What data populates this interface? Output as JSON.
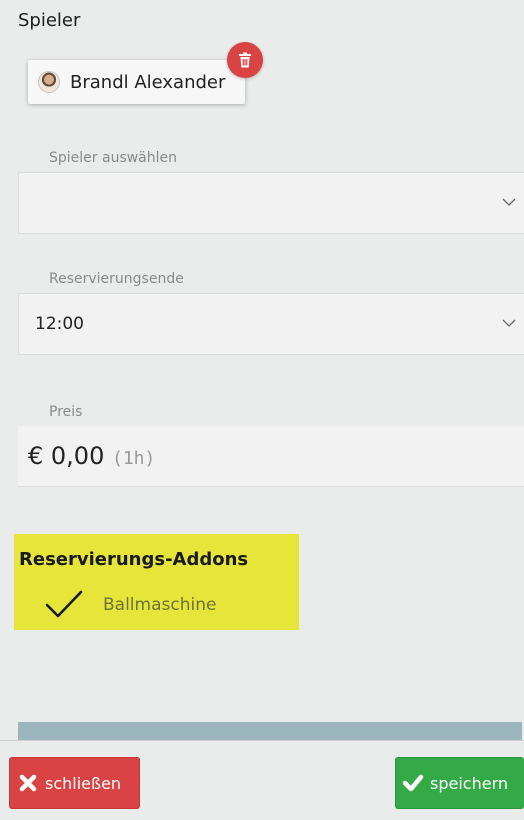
{
  "section": {
    "title": "Spieler"
  },
  "selected_player": {
    "name": "Brandl Alexander"
  },
  "player_select": {
    "label": "Spieler auswählen",
    "value": ""
  },
  "end_select": {
    "label": "Reservierungsende",
    "value": "12:00"
  },
  "price": {
    "label": "Preis",
    "amount": "€ 0,00",
    "duration": "(1h)"
  },
  "addons": {
    "title": "Reservierungs-Addons",
    "items": [
      {
        "label": "Ballmaschine",
        "checked": true
      }
    ]
  },
  "footer": {
    "close_label": "schließen",
    "save_label": "speichern"
  },
  "colors": {
    "danger": "#d94343",
    "success": "#33aa45",
    "highlight": "#e6e63a",
    "strip": "#9bb7bd"
  }
}
